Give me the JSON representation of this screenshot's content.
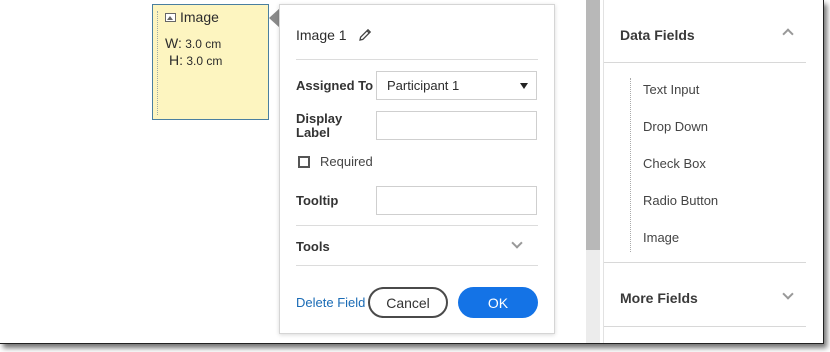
{
  "image_field": {
    "title": "Image",
    "width_label": "W:",
    "width_value": "3.0 cm",
    "height_label": "H:",
    "height_value": "3.0 cm"
  },
  "popover": {
    "field_name": "Image 1",
    "assigned_to_label": "Assigned To",
    "assigned_to_value": "Participant 1",
    "display_label_line1": "Display",
    "display_label_line2": "Label",
    "display_label_value": "",
    "required_label": "Required",
    "required_checked": false,
    "tooltip_label": "Tooltip",
    "tooltip_value": "",
    "tools_label": "Tools",
    "delete_link": "Delete Field",
    "cancel_button": "Cancel",
    "ok_button": "OK"
  },
  "sidebar": {
    "data_fields_header": "Data Fields",
    "items": [
      {
        "label": "Text Input"
      },
      {
        "label": "Drop Down"
      },
      {
        "label": "Check Box"
      },
      {
        "label": "Radio Button"
      },
      {
        "label": "Image"
      }
    ],
    "more_fields_header": "More Fields"
  },
  "colors": {
    "accent": "#1473e6",
    "link": "#1a6bb5",
    "field_bg": "#fdf5c0"
  }
}
